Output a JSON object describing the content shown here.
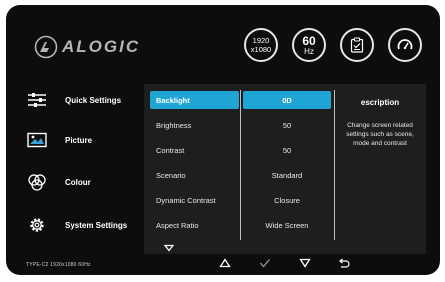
{
  "brand": {
    "logo_text": "ALOGIC"
  },
  "status": {
    "resolution_line1": "1920",
    "resolution_line2": "x1080",
    "refresh_value": "60",
    "refresh_unit": "Hz"
  },
  "sidebar": {
    "items": [
      {
        "label": "Quick Settings",
        "icon": "sliders-icon"
      },
      {
        "label": "Picture",
        "icon": "picture-icon"
      },
      {
        "label": "Colour",
        "icon": "colour-palette-icon"
      },
      {
        "label": "System Settings",
        "icon": "gear-icon"
      }
    ]
  },
  "menu": {
    "options": [
      "Backlight",
      "Brightness",
      "Contrast",
      "Scenario",
      "Dynamic Contrast",
      "Aspect Ratio"
    ],
    "values": [
      "0D",
      "50",
      "50",
      "Standard",
      "Closure",
      "Wide Screen"
    ],
    "selected_index": 0
  },
  "description": {
    "heading": "escription",
    "body": "Change screen related settings such as scene, mode and contrast"
  },
  "footer": {
    "info": "TYPE-C2 1920x1080 60Hz",
    "nav": [
      "up-arrow-icon",
      "check-icon",
      "down-arrow-icon",
      "back-icon"
    ]
  },
  "colors": {
    "accent": "#1fa5d3",
    "background": "#0d0d0d",
    "panel": "#1e1e1e"
  }
}
